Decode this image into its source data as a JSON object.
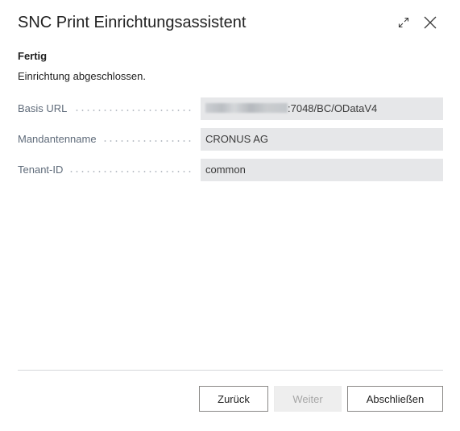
{
  "dialog": {
    "title": "SNC Print Einrichtungsassistent",
    "expand_icon": "expand-icon",
    "close_icon": "close-icon"
  },
  "section": {
    "title": "Fertig",
    "description": "Einrichtung abgeschlossen."
  },
  "fields": [
    {
      "label": "Basis URL",
      "value": ":7048/BC/ODataV4",
      "value_prefix_blurred": true
    },
    {
      "label": "Mandantenname",
      "value": "CRONUS AG"
    },
    {
      "label": "Tenant-ID",
      "value": "common"
    }
  ],
  "buttons": {
    "back": "Zurück",
    "next": "Weiter",
    "next_disabled": true,
    "finish": "Abschließen"
  }
}
